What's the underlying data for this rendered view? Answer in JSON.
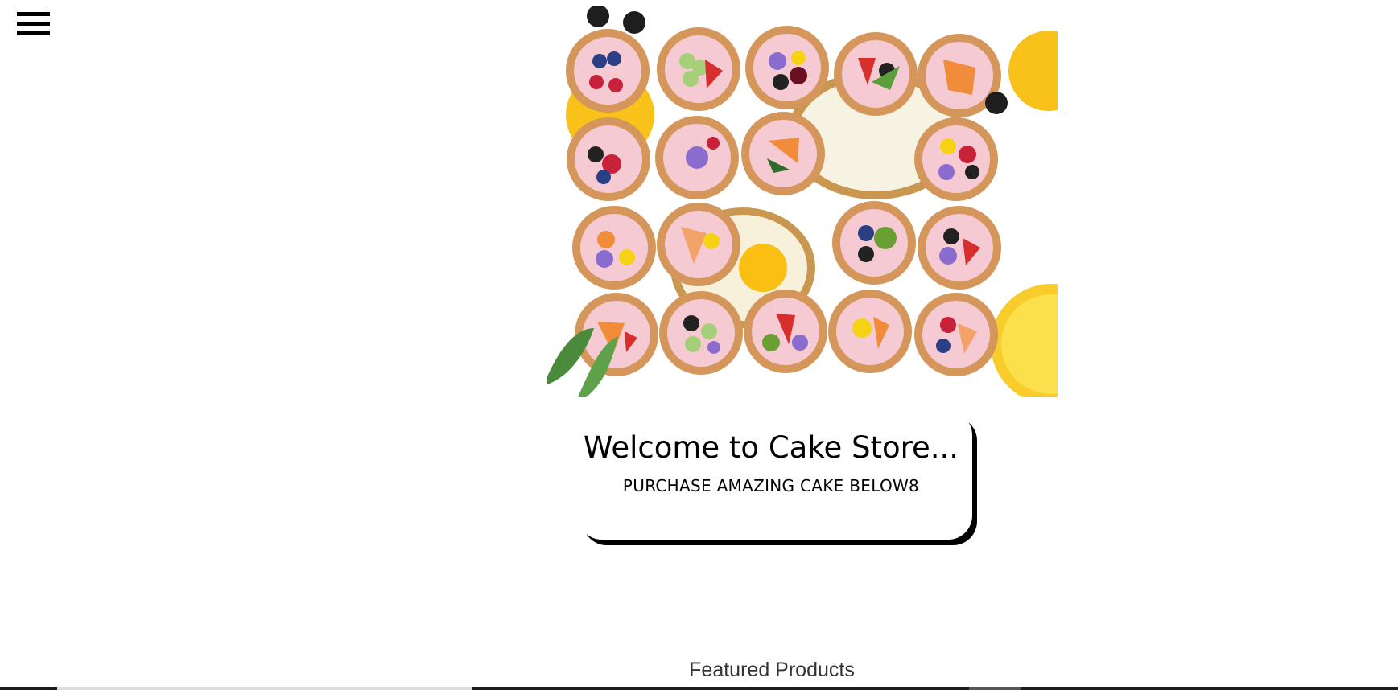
{
  "header": {
    "menu_icon": "hamburger-menu-icon"
  },
  "hero": {
    "image_desc_icon": "cake-collage-image"
  },
  "welcome": {
    "title": "Welcome to Cake Store...",
    "subtitle": "PURCHASE AMAZING CAKE BELOW8"
  },
  "featured": {
    "title": "Featured Products"
  },
  "colors": {
    "background": "#ffffff",
    "text": "#000000",
    "featured_text": "#333333"
  }
}
